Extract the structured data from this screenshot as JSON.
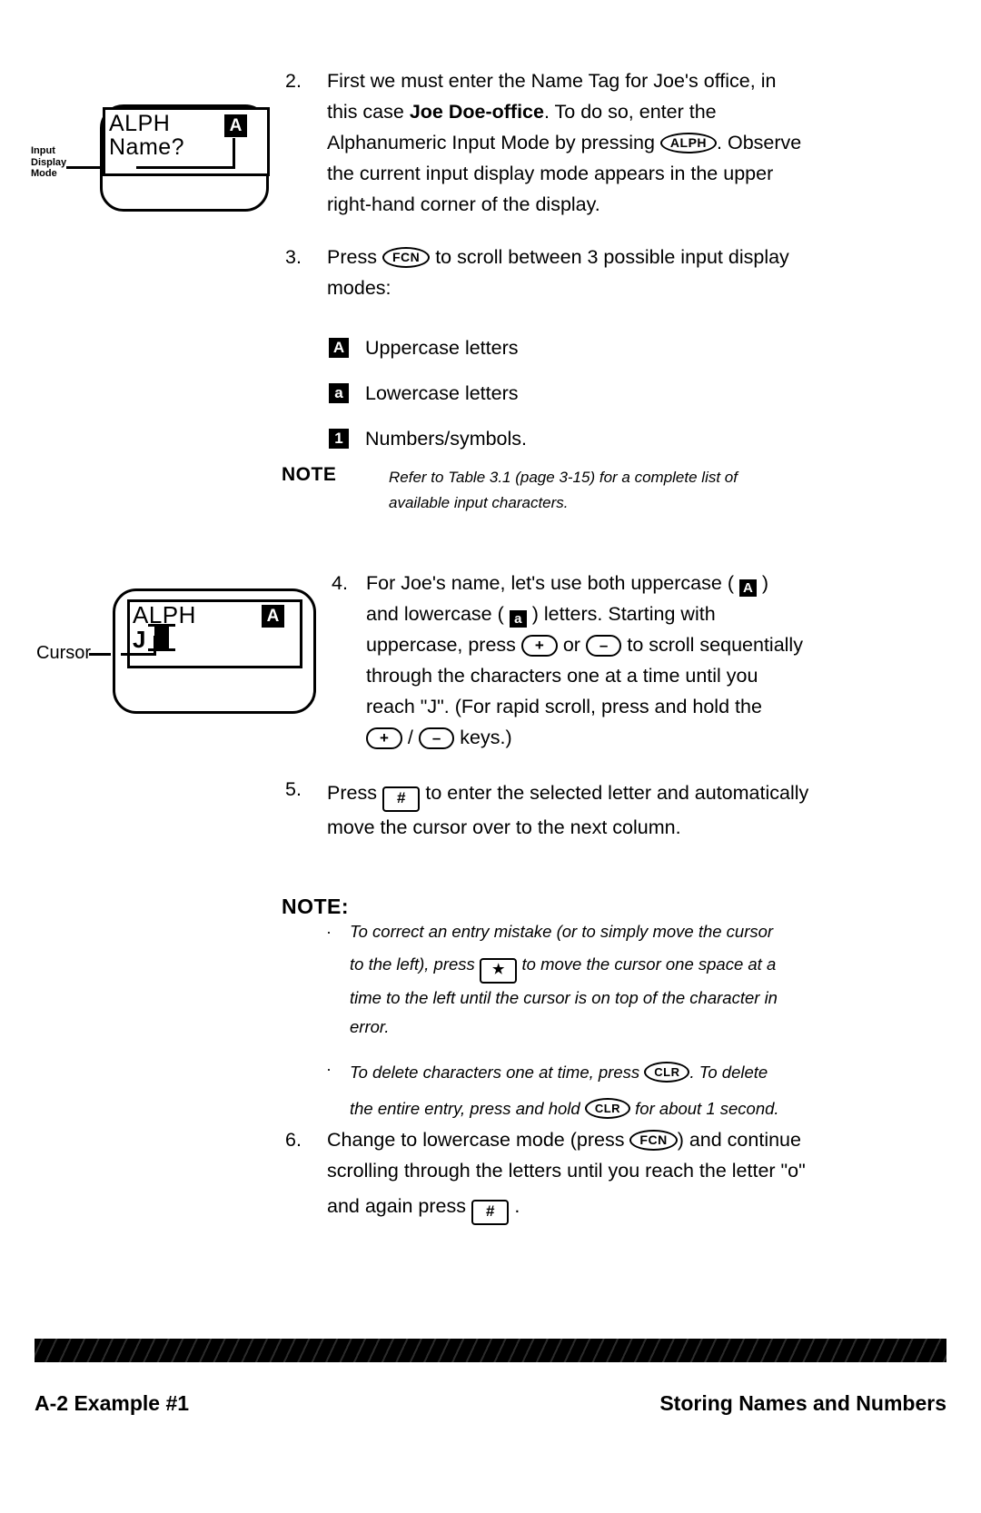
{
  "page": {
    "footer_left": "A-2    Example #1",
    "footer_right": "Storing Names and Numbers"
  },
  "figure1": {
    "label": "Input Display Mode",
    "screen_line1": "ALPH",
    "screen_line2": "Name?",
    "mode_indicator": "A"
  },
  "figure2": {
    "label": "Cursor",
    "screen_line1": "ALPH",
    "screen_line2": "J",
    "mode_indicator": "A"
  },
  "steps": {
    "s2": {
      "num": "2.",
      "t1": "First we must enter the Name Tag for Joe's office, in",
      "t2a": "this case ",
      "t2b": "Joe Doe-office",
      "t2c": ".  To do so, enter the",
      "t3a": "Alphanumeric Input Mode by pressing ",
      "t3key": "ALPH",
      "t3c": ".  Observe",
      "t4": "the current input display mode appears in the upper",
      "t5": "right-hand corner of the display."
    },
    "s3": {
      "num": "3.",
      "t1a": "Press ",
      "t1key": "FCN",
      "t1b": " to scroll between 3 possible input display",
      "t2": "modes:",
      "modes": [
        {
          "glyph": "A",
          "label": "Uppercase letters"
        },
        {
          "glyph": "a",
          "label": "Lowercase letters"
        },
        {
          "glyph": "1",
          "label": "Numbers/symbols."
        }
      ]
    },
    "note1": {
      "label": "NOTE",
      "l1": "Refer to Table 3.1 (page 3-15) for a complete list of",
      "l2": "available input characters."
    },
    "s4": {
      "num": "4.",
      "t1a": "For Joe's name, let's use both uppercase ( ",
      "t1glyph": "A",
      "t1b": " )",
      "t2a": "and lowercase ( ",
      "t2glyph": "a",
      "t2b": " ) letters.  Starting with",
      "t3a": "uppercase, press ",
      "t3k1": "+",
      "t3b": " or ",
      "t3k2": "–",
      "t3c": " to scroll sequentially",
      "t4": "through the characters one at a time until you",
      "t5": "reach \"J\".  (For rapid scroll, press and hold the",
      "t6a": "+",
      "t6b": " / ",
      "t6c": "–",
      "t6d": " keys.)"
    },
    "s5": {
      "num": "5.",
      "t1a": "Press ",
      "t1key": "#",
      "t1b": " to enter the selected letter and automatically",
      "t2": "move the cursor over to the next column."
    },
    "note2": {
      "label": "NOTE:",
      "b1l1": "To correct an entry mistake (or to simply move the cursor",
      "b1l2a": "to the left), press ",
      "b1key": "★",
      "b1l2b": " to move the cursor one space at a",
      "b1l3": "time to the left until the cursor is on top of the character in",
      "b1l4": "error.",
      "b2l1a": "To delete characters one at time, press ",
      "b2key1": "CLR",
      "b2l1b": ".   To delete",
      "b2l2a": "the entire entry, press and hold ",
      "b2key2": "CLR",
      "b2l2b": " for about 1 second."
    },
    "s6": {
      "num": "6.",
      "t1a": "Change to lowercase mode (press ",
      "t1key": "FCN",
      "t1b": ")  and continue",
      "t2": "scrolling through the letters until you reach the letter \"o\"",
      "t3a": "and again press ",
      "t3key": "#",
      "t3b": " ."
    }
  }
}
